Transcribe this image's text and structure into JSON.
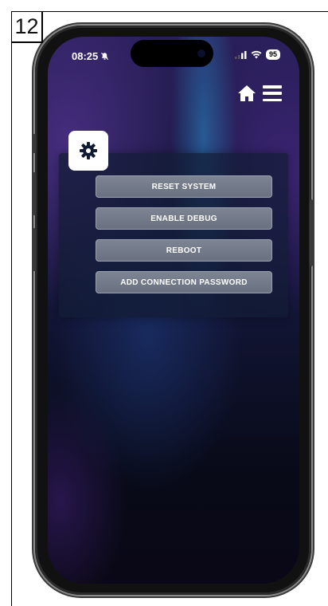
{
  "figure": {
    "step_number": "12"
  },
  "status_bar": {
    "time": "08:25",
    "battery": "95"
  },
  "settings": {
    "buttons": [
      {
        "label": "RESET SYSTEM"
      },
      {
        "label": "ENABLE DEBUG"
      },
      {
        "label": "REBOOT"
      },
      {
        "label": "ADD CONNECTION PASSWORD"
      }
    ]
  },
  "icons": {
    "settings": "gear-icon",
    "home": "home-icon",
    "menu": "hamburger-menu-icon",
    "silent": "bell-slash-icon",
    "signal": "signal-icon",
    "wifi": "wifi-icon"
  },
  "colors": {
    "button_bg": "#737a8a",
    "panel_bg": "#121c34",
    "screen_top": "#2a1f5a",
    "screen_bottom": "#080a18"
  }
}
